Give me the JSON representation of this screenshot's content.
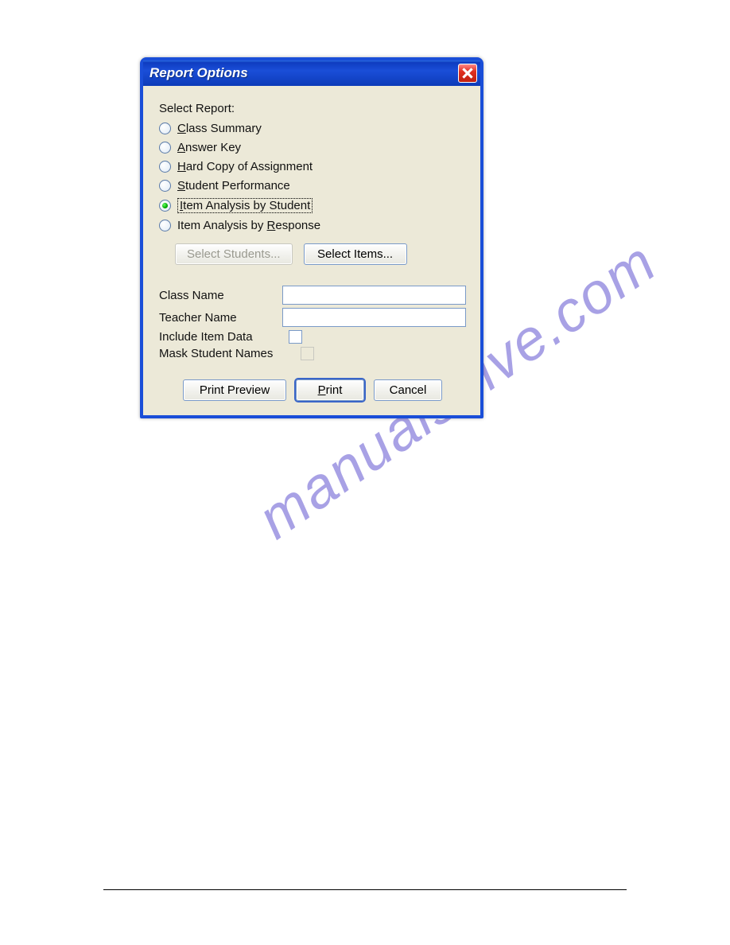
{
  "watermark": "manualshive.com",
  "dialog": {
    "title": "Report Options",
    "select_label": "Select Report:",
    "radios": {
      "class_summary": {
        "pre": "",
        "ul": "C",
        "post": "lass Summary"
      },
      "answer_key": {
        "pre": "",
        "ul": "A",
        "post": "nswer Key"
      },
      "hard_copy": {
        "pre": "",
        "ul": "H",
        "post": "ard Copy of Assignment"
      },
      "student_perf": {
        "pre": "",
        "ul": "S",
        "post": "tudent Performance"
      },
      "item_by_student": {
        "pre": "",
        "ul": "I",
        "post": "tem Analysis by Student"
      },
      "item_by_response": {
        "pre": "Item Analysis by ",
        "ul": "R",
        "post": "esponse"
      }
    },
    "buttons": {
      "select_students": "Select Students...",
      "select_items": "Select Items...",
      "print_preview": "Print Preview",
      "print": {
        "pre": "",
        "ul": "P",
        "post": "rint"
      },
      "cancel": "Cancel"
    },
    "fields": {
      "class_name_label": "Class Name",
      "class_name_value": "",
      "teacher_name_label": "Teacher Name",
      "teacher_name_value": "",
      "include_item_data_label": "Include Item Data",
      "mask_student_names_label": "Mask Student Names"
    }
  }
}
